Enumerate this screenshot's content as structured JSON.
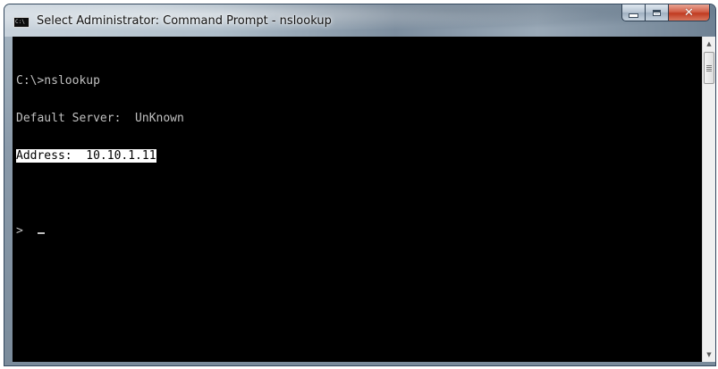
{
  "window": {
    "title": "Select Administrator: Command Prompt - nslookup",
    "icon": "cmd-icon",
    "icon_text": "C:\\"
  },
  "controls": {
    "minimize": "minimize-icon",
    "maximize": "maximize-icon",
    "close": "close-icon",
    "close_glyph": "✕"
  },
  "console": {
    "lines": [
      "C:\\>nslookup",
      "Default Server:  UnKnown",
      "Address:  10.10.1.11",
      "",
      "> "
    ],
    "highlighted_line": "Address:  10.10.1.11",
    "text_color": "#c0c0c0",
    "background": "#000000"
  },
  "scrollbar": {
    "up_arrow": "▲",
    "down_arrow": "▼"
  }
}
